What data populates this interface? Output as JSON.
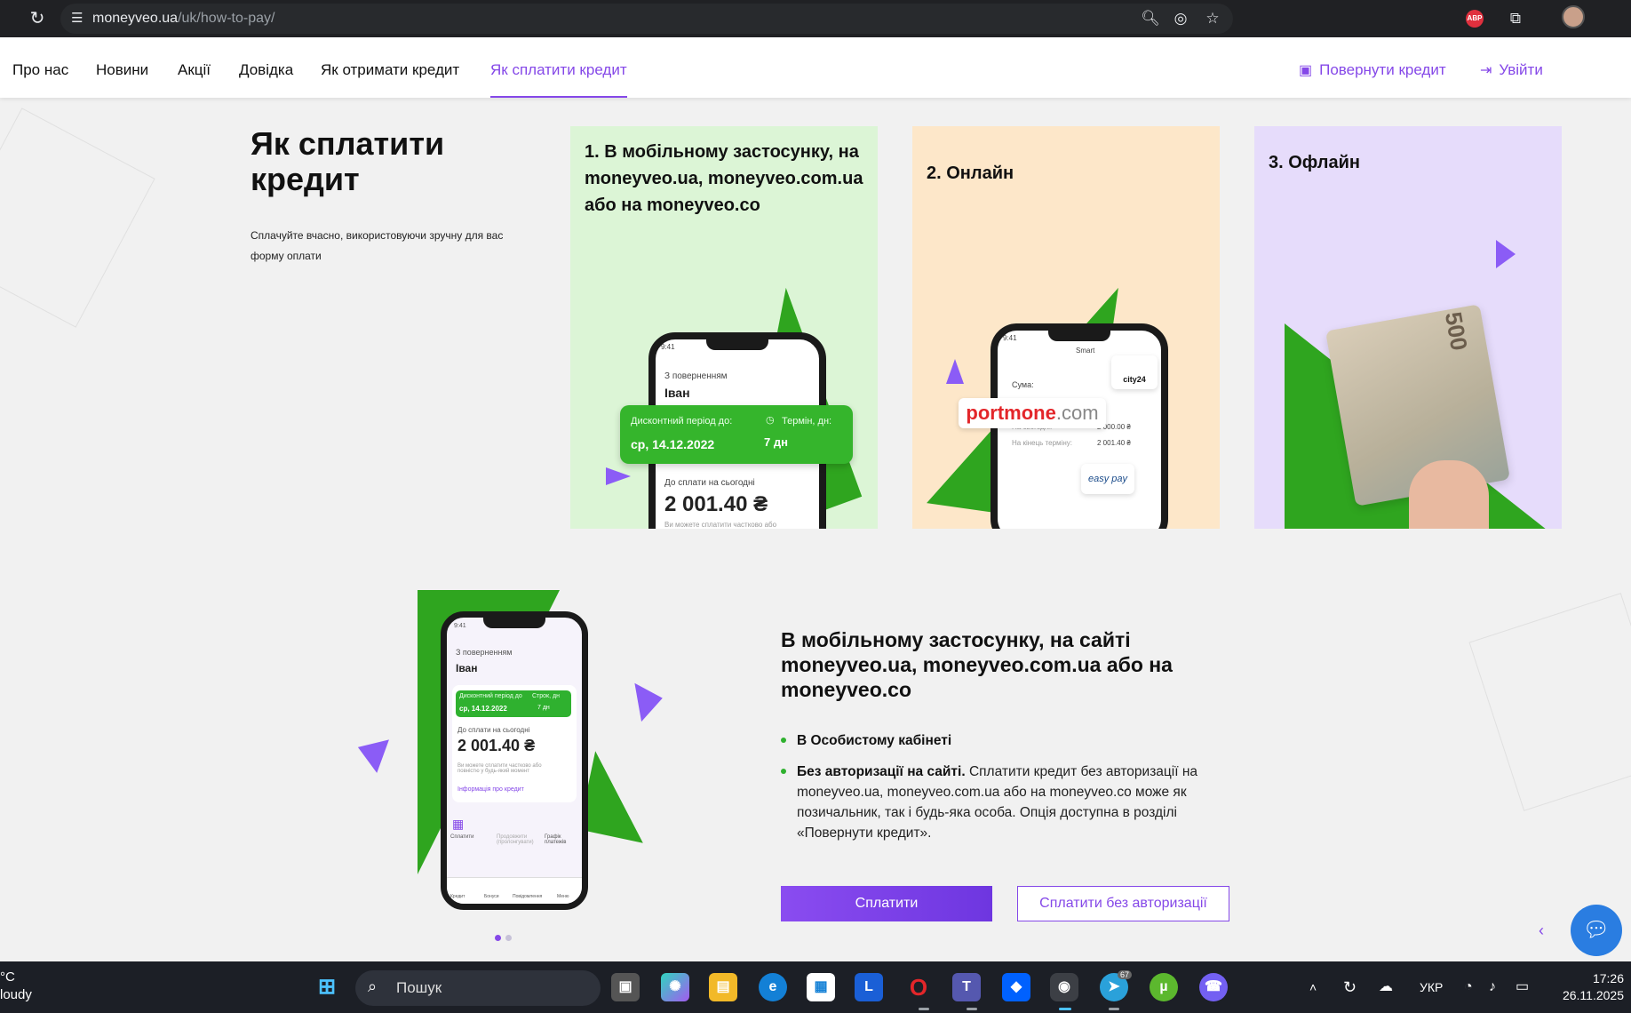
{
  "browser": {
    "url_host": "moneyveo.ua",
    "url_path": "/uk/how-to-pay/",
    "abp_label": "ABP"
  },
  "nav": {
    "items": [
      "Про нас",
      "Новини",
      "Акції",
      "Довідка",
      "Як отримати кредит",
      "Як сплатити кредит"
    ],
    "active_index": 5,
    "return_credit": "Повернути кредит",
    "login": "Увійти"
  },
  "hero": {
    "title": "Як сплатити кредит",
    "subtitle": "Сплачуйте вчасно, використовуючи зручну для вас форму оплати"
  },
  "cards": [
    {
      "title": "1. В мобільному застосунку, на moneyveo.ua, moneyveo.com.ua або на moneyveo.co",
      "color": "#dcf5d6",
      "phone": {
        "time": "9:41",
        "greeting": "З поверненням",
        "name": "Іван",
        "discount_label": "Дисконтний період до:",
        "discount_date": "ср, 14.12.2022",
        "term_label": "Термін, дн:",
        "term_value": "7 дн",
        "due_label": "До сплати на сьогодні",
        "due_amount": "2 001.40 ₴",
        "note": "Ви можете сплатити частково або повністю у будь-який момент"
      }
    },
    {
      "title": "2. Онлайн",
      "color": "#fde7c9",
      "phone": {
        "time": "9:41",
        "header": "Smart",
        "sum_label": "Сума:",
        "today_label": "На сьогодні:",
        "today_value": "2 000.00 ₴",
        "end_label": "На кінець терміну:",
        "end_value": "2 001.40 ₴"
      },
      "logos": {
        "portmone": "portmone",
        "portmone_suffix": ".com",
        "city24": "city24",
        "easypay": "easy pay"
      }
    },
    {
      "title": "3. Офлайн",
      "color": "#e6dcfb",
      "banknote": "500"
    }
  ],
  "section": {
    "title": "В мобільному застосунку, на сайті moneyveo.ua, moneyveo.com.ua або на moneyveo.co",
    "bullet1": "В Особистому кабінеті",
    "bullet2_bold": "Без авторизації на сайті.",
    "bullet2_text": " Сплатити кредит без авторизації на moneyveo.ua, moneyveo.com.ua або на moneyveo.co може як позичальник, так і будь-яка особа. Опція доступна в розділі «Повернути кредит».",
    "pay_button": "Сплатити",
    "pay_noauth_button": "Сплатити без авторизації",
    "phone": {
      "time": "9:41",
      "greeting": "З поверненням",
      "name": "Іван",
      "discount_label": "Дисконтний період до",
      "discount_date": "ср, 14.12.2022",
      "term_label": "Строк, дн",
      "term_value": "7 дн",
      "due_label": "До сплати на сьогодні",
      "due_amount": "2 001.40 ₴",
      "note": "Ви можете сплатити частково або повністю у будь-який момент",
      "info_link": "Інформація про кредит",
      "tab1": "Сплатити",
      "tab2": "Продовжити (пролонгувати)",
      "tab3": "Графік платежів",
      "bottom": [
        "Кредит",
        "Бонуси",
        "Повідомлення",
        "Меню"
      ]
    }
  },
  "carousel": {
    "slides": 2,
    "active": 0
  },
  "taskbar": {
    "weather_line1": "°C",
    "weather_line2": "loudy",
    "search_placeholder": "Пошук",
    "telegram_badge": "67",
    "lang": "УКР",
    "time": "17:26",
    "date": "26.11.2025"
  }
}
